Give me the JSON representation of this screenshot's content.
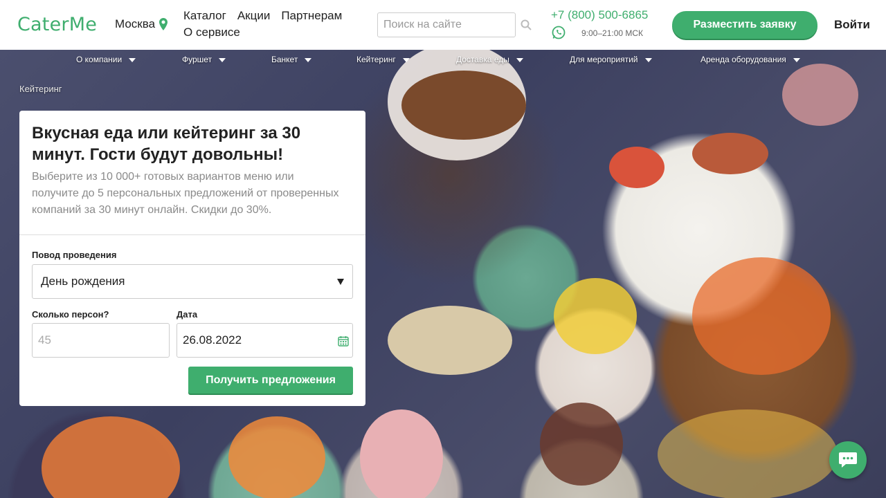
{
  "header": {
    "logo": "CaterMe",
    "city": "Москва",
    "nav": [
      "Каталог",
      "Акции",
      "Партнерам",
      "О сервисе"
    ],
    "search_placeholder": "Поиск на сайте",
    "phone": "+7 (800) 500-6865",
    "hours": "9:00–21:00 МСК",
    "cta_label": "Разместить заявку",
    "login_label": "Войти"
  },
  "catnav": [
    "О компании",
    "Фуршет",
    "Банкет",
    "Кейтеринг",
    "Доставка еды",
    "Для мероприятий",
    "Аренда оборудования"
  ],
  "breadcrumb": "Кейтеринг",
  "form": {
    "title": "Вкусная еда или кейтеринг за 30 минут. Гости будут довольны!",
    "lead": "Выберите из 10 000+ готовых вариантов меню или получите до 5 персональных предложений от проверенных компаний за 30 минут онлайн. Скидки до 30%.",
    "occasion_label": "Повод проведения",
    "occasion_value": "День рождения",
    "persons_label": "Сколько персон?",
    "persons_placeholder": "45",
    "date_label": "Дата",
    "date_value": "26.08.2022",
    "submit_label": "Получить предложения"
  },
  "colors": {
    "brand_green": "#3fae6e"
  }
}
